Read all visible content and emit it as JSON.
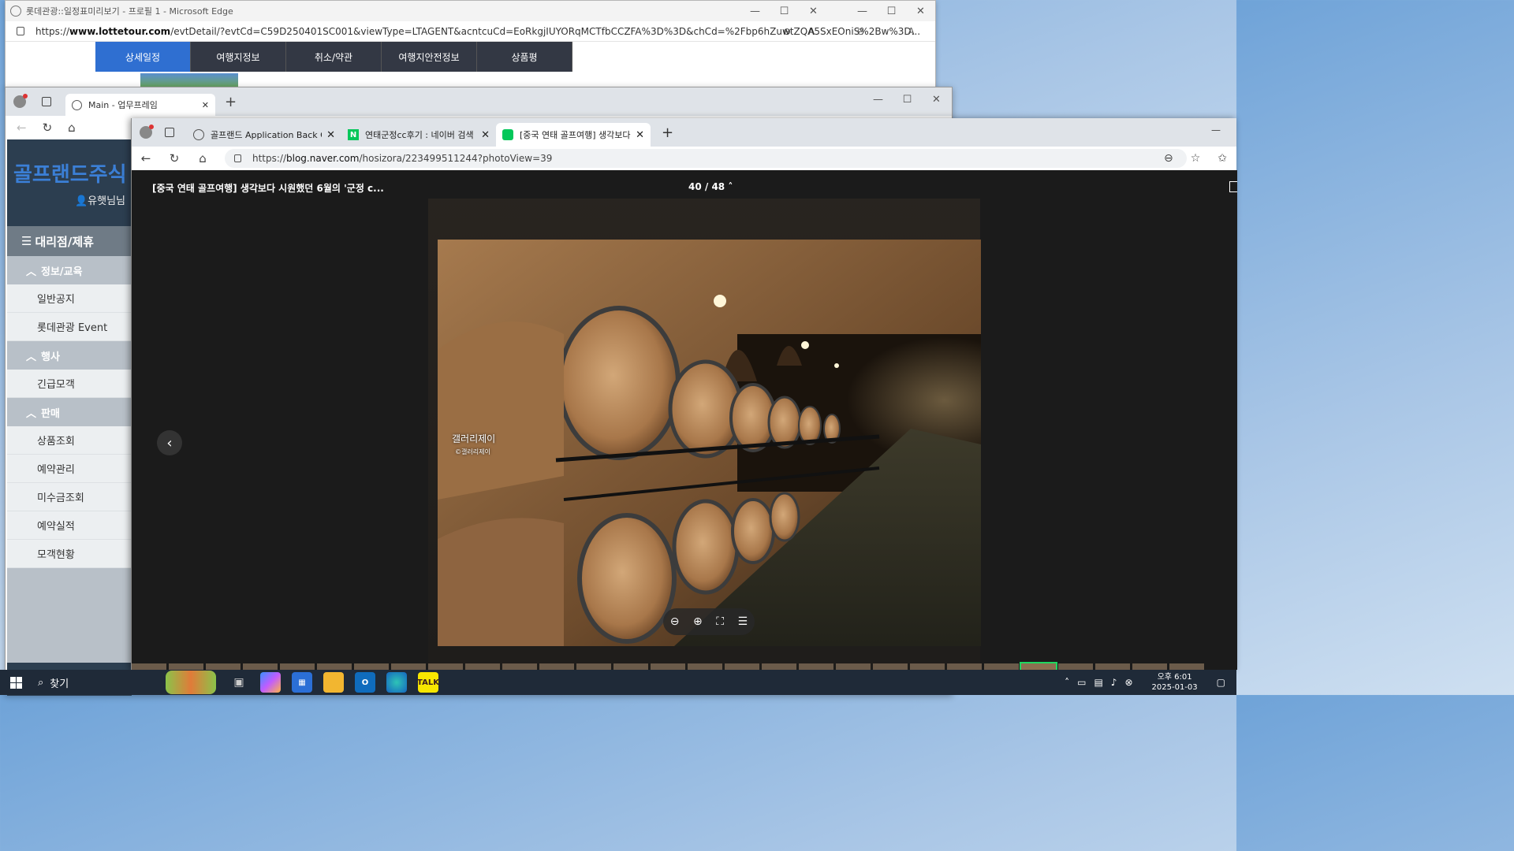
{
  "lotte_window": {
    "title": "롯데관광::일정표미리보기 - 프로필 1 - Microsoft Edge",
    "url_prefix": "https://",
    "url_host": "www.lottetour.com",
    "url_path": "/evtDetail/?evtCd=C59D250401SC001&viewType=LTAGENT&acntcuCd=EoRkgjIUYORqMCTfbCCZFA%3D%3D&chCd=%2Fbp6hZuwtZQA5SxEOniS%2Bw%3D...",
    "tabs": [
      "상세일정",
      "여행지정보",
      "취소/약관",
      "여행지안전정보",
      "상품평"
    ]
  },
  "main_window": {
    "tab_title": "Main - 업무프레임",
    "brand": "골프랜드주식",
    "user": "유햇님님",
    "sidebar": {
      "section": "대리점/제휴",
      "groups": [
        {
          "label": "정보/교육",
          "items": [
            "일반공지",
            "롯데관광 Event"
          ]
        },
        {
          "label": "행사",
          "items": [
            "긴급모객"
          ]
        },
        {
          "label": "판매",
          "items": [
            "상품조회",
            "예약관리",
            "미수금조회",
            "예약실적",
            "모객현황"
          ]
        }
      ]
    }
  },
  "naver_window": {
    "tabs": [
      {
        "label": "골프랜드 Application Back Office",
        "icon": "globe-icon"
      },
      {
        "label": "연태군정cc후기 : 네이버 검색",
        "icon": "naver-icon"
      },
      {
        "label": "[중국 연태 골프여행] 생각보다 시",
        "icon": "blog-icon"
      }
    ],
    "url_prefix": "https://",
    "url_host": "blog.naver.com",
    "url_path": "/hosizora/223499511244?photoView=39",
    "viewer": {
      "title": "[중국 연태 골프여행] 생각보다 시원했던 6월의 '군정 c...",
      "counter": "40 / 48",
      "watermark_name": "갤러리제이",
      "watermark_copy": "©갤러리제이"
    }
  },
  "taskbar": {
    "search_label": "찾기",
    "time": "오후 6:01",
    "date": "2025-01-03"
  },
  "colors": {
    "lotte_active_tab": "#2f6fd1",
    "lotte_tab": "#333844",
    "sidebar_brand": "#3b7fd6",
    "naver_green": "#03c75a"
  }
}
